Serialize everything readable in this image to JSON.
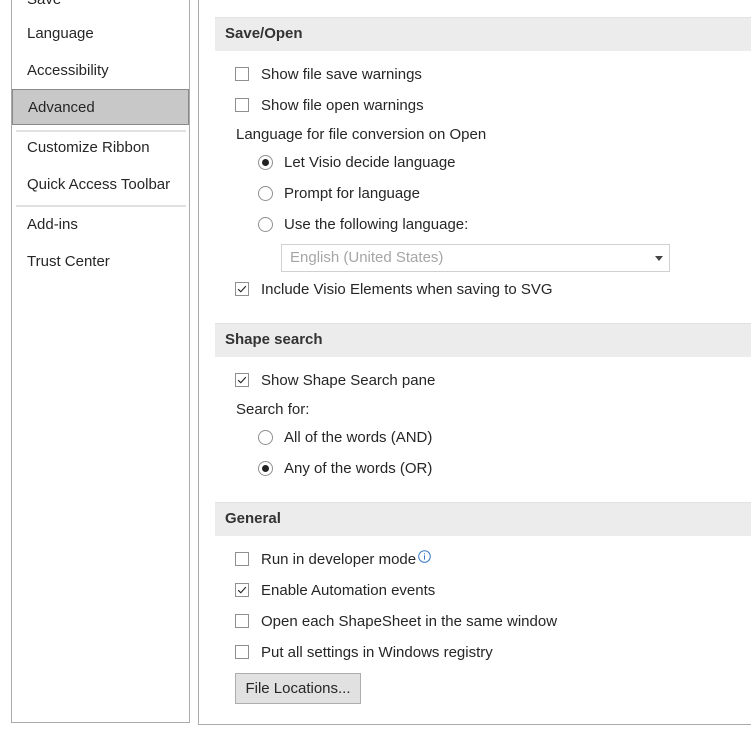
{
  "nav": {
    "items": [
      {
        "label": "Save",
        "selected": false
      },
      {
        "label": "Language",
        "selected": false
      },
      {
        "label": "Accessibility",
        "selected": false
      },
      {
        "label": "Advanced",
        "selected": true
      },
      {
        "label": "Customize Ribbon",
        "selected": false
      },
      {
        "label": "Quick Access Toolbar",
        "selected": false
      },
      {
        "label": "Add-ins",
        "selected": false
      },
      {
        "label": "Trust Center",
        "selected": false
      }
    ]
  },
  "save_open": {
    "title": "Save/Open",
    "show_file_save_warnings": {
      "label": "Show file save warnings",
      "checked": false
    },
    "show_file_open_warnings": {
      "label": "Show file open warnings",
      "checked": false
    },
    "language_heading": "Language for file conversion on Open",
    "opt_let_visio": {
      "label": "Let Visio decide language",
      "selected": true
    },
    "opt_prompt": {
      "label": "Prompt for language",
      "selected": false
    },
    "opt_use_following": {
      "label": "Use the following language:",
      "selected": false
    },
    "language_select": {
      "value": "English (United States)",
      "enabled": false
    },
    "include_visio_elements": {
      "label": "Include Visio Elements when saving to SVG",
      "checked": true
    }
  },
  "shape_search": {
    "title": "Shape search",
    "show_pane": {
      "label": "Show Shape Search pane",
      "checked": true
    },
    "search_for_label": "Search for:",
    "opt_all": {
      "label": "All of the words (AND)",
      "selected": false
    },
    "opt_any": {
      "label": "Any of the words (OR)",
      "selected": true
    }
  },
  "general": {
    "title": "General",
    "developer_mode": {
      "label": "Run in developer mode",
      "checked": false
    },
    "automation_events": {
      "label": "Enable Automation events",
      "checked": true
    },
    "open_shapesheet": {
      "label": "Open each ShapeSheet in the same window",
      "checked": false
    },
    "registry": {
      "label": "Put all settings in Windows registry",
      "checked": false
    },
    "file_locations_button": "File Locations..."
  },
  "icons": {
    "info": "info-icon",
    "dropdown": "chevron-down-icon",
    "check": "check-icon"
  },
  "colors": {
    "selected_nav": "#c8c8c8",
    "section_header": "#ececec",
    "text": "#262626"
  }
}
